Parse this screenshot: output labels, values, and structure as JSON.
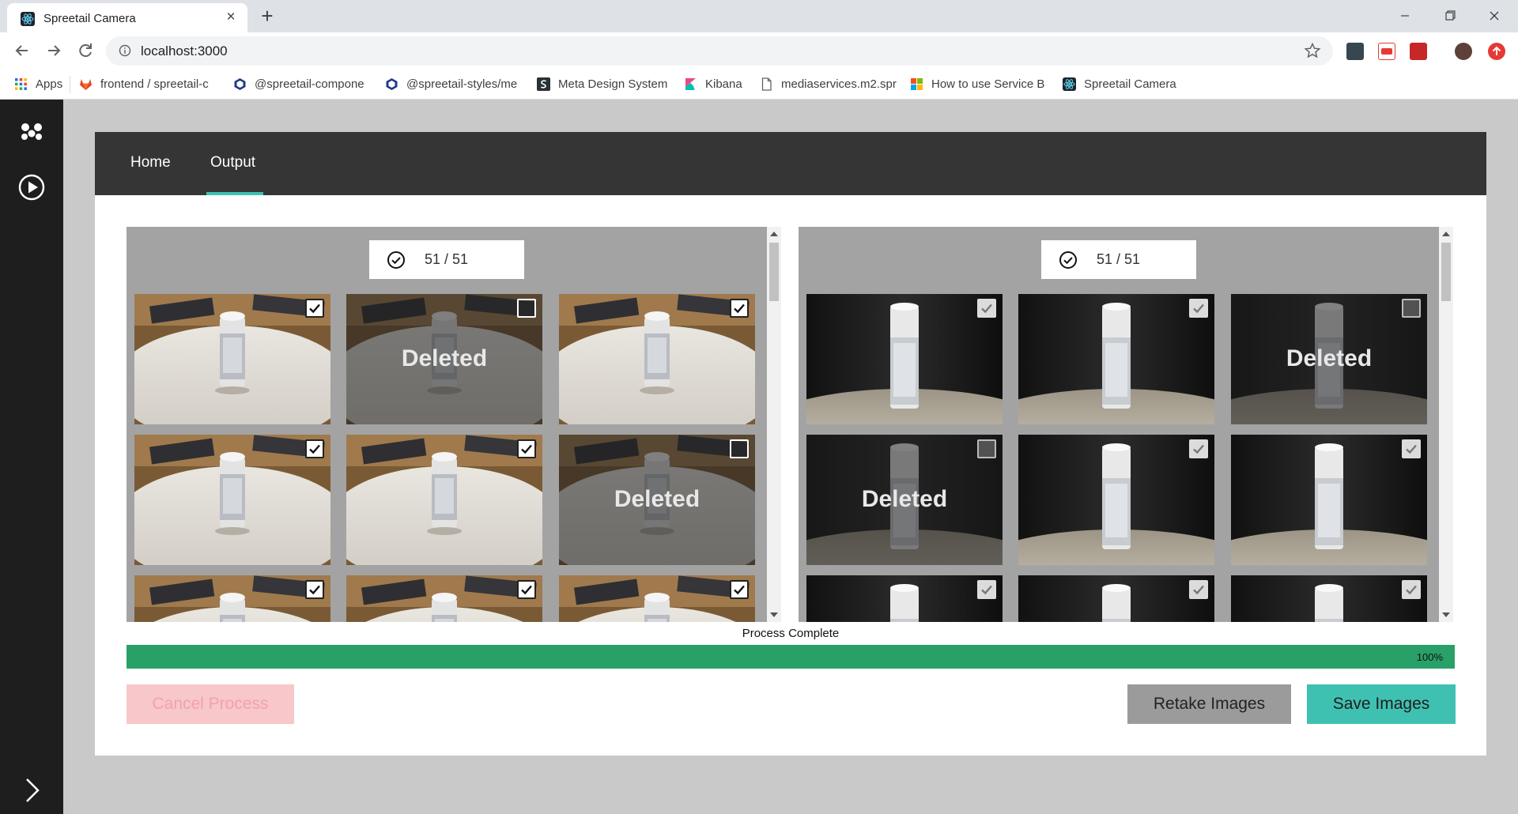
{
  "browser": {
    "tab_title": "Spreetail Camera",
    "url": "localhost:3000",
    "bookmarks": [
      {
        "label": "Apps",
        "icon": "apps-grid-icon"
      },
      {
        "label": "frontend / spreetail-c",
        "icon": "gitlab-icon"
      },
      {
        "label": "@spreetail-compone",
        "icon": "package-icon"
      },
      {
        "label": "@spreetail-styles/me",
        "icon": "package-icon"
      },
      {
        "label": "Meta Design System",
        "icon": "design-system-icon"
      },
      {
        "label": "Kibana",
        "icon": "kibana-icon"
      },
      {
        "label": "mediaservices.m2.spr",
        "icon": "document-icon"
      },
      {
        "label": "How to use Service B",
        "icon": "microsoft-icon"
      },
      {
        "label": "Spreetail Camera",
        "icon": "react-icon"
      }
    ]
  },
  "app": {
    "nav": {
      "home": "Home",
      "output": "Output",
      "active": "Output"
    },
    "left_panel": {
      "counter": "51 / 51",
      "images": [
        {
          "checked": true,
          "deleted": false
        },
        {
          "checked": false,
          "deleted": true,
          "label": "Deleted"
        },
        {
          "checked": true,
          "deleted": false
        },
        {
          "checked": true,
          "deleted": false
        },
        {
          "checked": true,
          "deleted": false
        },
        {
          "checked": false,
          "deleted": true,
          "label": "Deleted"
        },
        {
          "checked": true,
          "deleted": false
        },
        {
          "checked": true,
          "deleted": false
        },
        {
          "checked": true,
          "deleted": false
        }
      ]
    },
    "right_panel": {
      "counter": "51 / 51",
      "images": [
        {
          "checked": true,
          "deleted": false
        },
        {
          "checked": true,
          "deleted": false
        },
        {
          "checked": false,
          "deleted": true,
          "label": "Deleted"
        },
        {
          "checked": false,
          "deleted": true,
          "label": "Deleted"
        },
        {
          "checked": true,
          "deleted": false
        },
        {
          "checked": true,
          "deleted": false
        },
        {
          "checked": true,
          "deleted": false
        },
        {
          "checked": true,
          "deleted": false
        },
        {
          "checked": true,
          "deleted": false
        }
      ]
    },
    "status": "Process Complete",
    "progress": {
      "value": 1.0,
      "label": "100%"
    },
    "buttons": {
      "cancel": "Cancel Process",
      "retake": "Retake Images",
      "save": "Save Images"
    },
    "colors": {
      "accent": "#3fc1b2",
      "progress": "#28a068",
      "nav_bg": "#353535",
      "sidebar_bg": "#1e1e1e",
      "cancel_bg": "#f7c7ca"
    }
  }
}
